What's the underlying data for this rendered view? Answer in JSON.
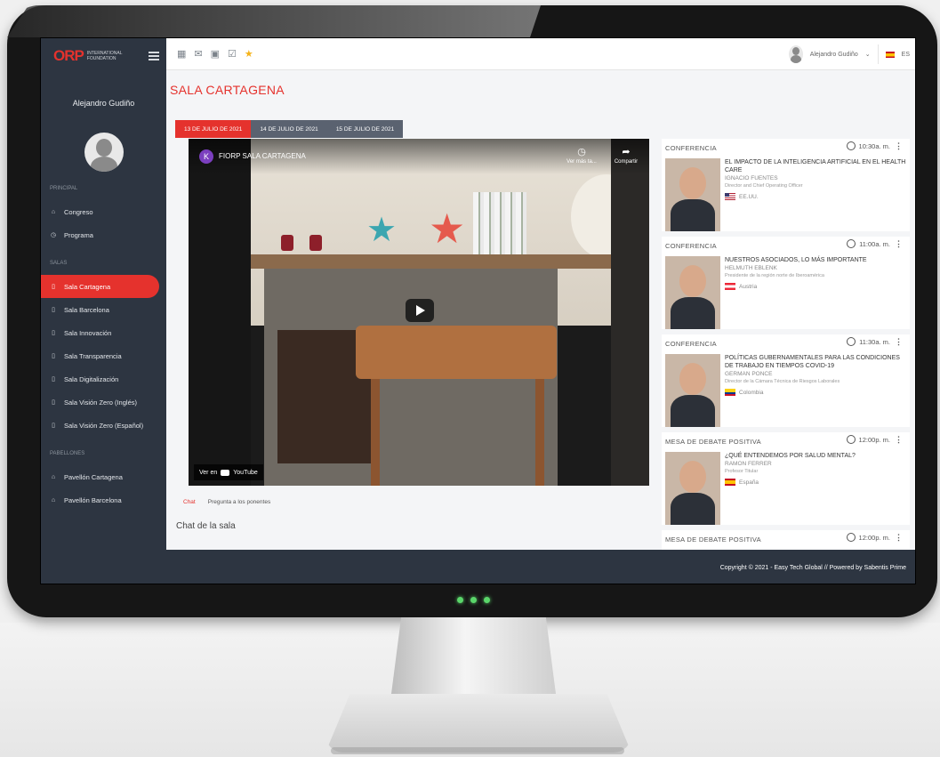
{
  "sidebar": {
    "brand": {
      "logo": "ORP",
      "sub": "INTERNATIONAL FOUNDATION"
    },
    "user_name": "Alejandro Gudiño",
    "sections": {
      "principal": "PRINCIPAL",
      "salas": "SALAS",
      "pabellones": "PABELLONES"
    },
    "principal_items": [
      {
        "label": "Congreso",
        "icon": "home-icon"
      },
      {
        "label": "Programa",
        "icon": "clock-icon"
      }
    ],
    "salas_items": [
      {
        "label": "Sala Cartagena",
        "active": true
      },
      {
        "label": "Sala Barcelona"
      },
      {
        "label": "Sala Innovación"
      },
      {
        "label": "Sala Transparencia"
      },
      {
        "label": "Sala Digitalización"
      },
      {
        "label": "Sala Visión Zero (Inglés)"
      },
      {
        "label": "Sala Visión Zero (Español)"
      }
    ],
    "pabellones_items": [
      {
        "label": "Pavellón Cartagena"
      },
      {
        "label": "Pavellón Barcelona"
      }
    ]
  },
  "topbar": {
    "icons": [
      "calendar-icon",
      "mail-icon",
      "chat-icon",
      "checkbox-icon",
      "star-icon"
    ],
    "user_name": "Alejandro Gudiño",
    "dropdown": "⌄",
    "language": "ES"
  },
  "page": {
    "title": "SALA CARTAGENA"
  },
  "tabs": [
    "13 DE JULIO DE 2021",
    "14 DE JULIO DE 2021",
    "15 DE JULIO DE 2021"
  ],
  "video": {
    "channel_initial": "K",
    "title": "FIORP SALA CARTAGENA",
    "watch_later": "Ver más ta...",
    "share": "Compartir",
    "watch_on": "Ver en",
    "youtube": "YouTube"
  },
  "chat": {
    "tabs": [
      "Chat",
      "Pregunta a los ponentes"
    ],
    "title": "Chat de la sala"
  },
  "agenda": [
    {
      "type": "CONFERENCIA",
      "time": "10:30a. m.",
      "title": "EL IMPACTO DE LA INTELIGENCIA ARTIFICIAL EN EL HEALTH CARE",
      "speaker": "IGNACIO FUENTES",
      "position": "Director and Chief Operating Officer",
      "country": "EE.UU.",
      "flag": "us"
    },
    {
      "type": "CONFERENCIA",
      "time": "11:00a. m.",
      "title": "NUESTROS ASOCIADOS, LO MÁS IMPORTANTE",
      "speaker": "HELMUTH EBLENK",
      "position": "Presidente de la región norte de Iberoamérica",
      "country": "Austria",
      "flag": "at"
    },
    {
      "type": "CONFERENCIA",
      "time": "11:30a. m.",
      "title": "POLÍTICAS GUBERNAMENTALES PARA LAS CONDICIONES DE TRABAJO EN TIEMPOS COVID-19",
      "speaker": "GERMAN PONCE",
      "position": "Director de la Cámara Técnica de Riesgos Laborales",
      "country": "Colombia",
      "flag": "co"
    },
    {
      "type": "MESA DE DEBATE POSITIVA",
      "time": "12:00p. m.",
      "title": "¿QUÉ ENTENDEMOS POR SALUD MENTAL?",
      "speaker": "RAMON FERRER",
      "position": "Profesor Titular",
      "country": "España",
      "flag": "es"
    },
    {
      "type": "MESA DE DEBATE POSITIVA",
      "time": "12:00p. m.",
      "title": "",
      "speaker": "",
      "position": "",
      "country": "",
      "flag": ""
    }
  ],
  "footer": {
    "copyright": "Copyright © 2021 - Easy Tech Global // Powered by Sabentis Prime"
  }
}
